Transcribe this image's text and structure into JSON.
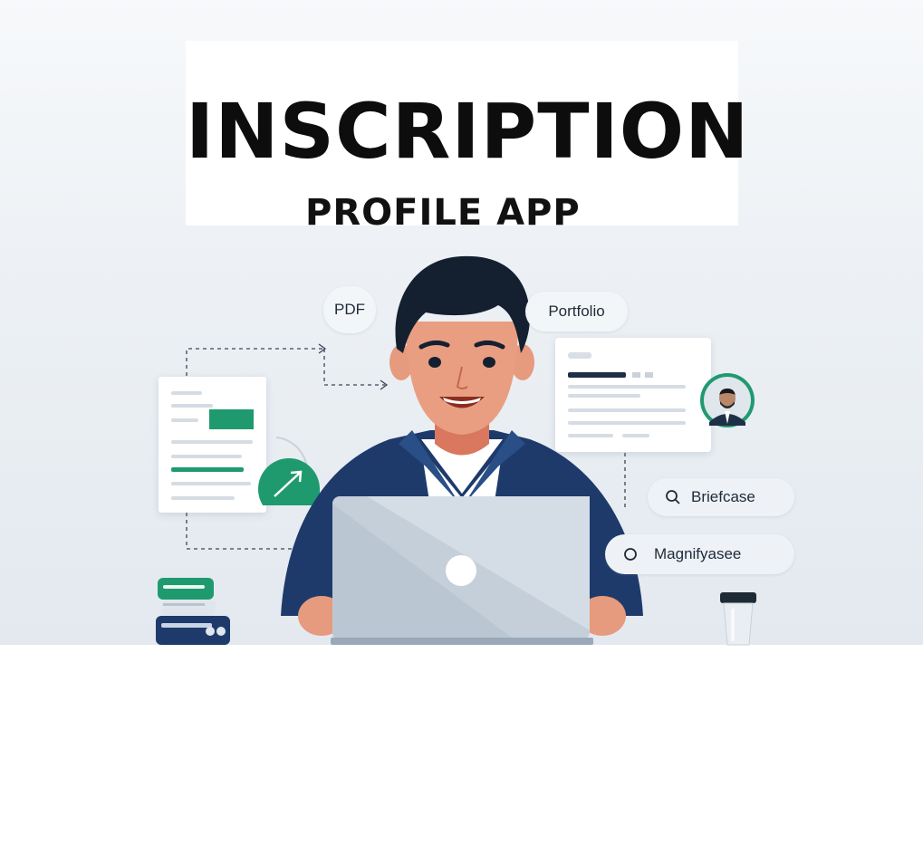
{
  "header": {
    "title": "INSCRIPTION",
    "subtitle": "PROFILE APP"
  },
  "tags": {
    "pdf": "PDF",
    "portfolio": "Portfolio",
    "briefcase": "Briefcase",
    "magnify": "Magnifyasee"
  },
  "icons": {
    "briefcase_icon": "search-icon",
    "magnify_icon": "circle-icon",
    "check_icon": "checkmark-icon",
    "avatar": "user-avatar-icon"
  },
  "colors": {
    "accent_green": "#1f9a6f",
    "jacket_navy": "#1e3a6b",
    "title_text": "#0d0d0d"
  }
}
